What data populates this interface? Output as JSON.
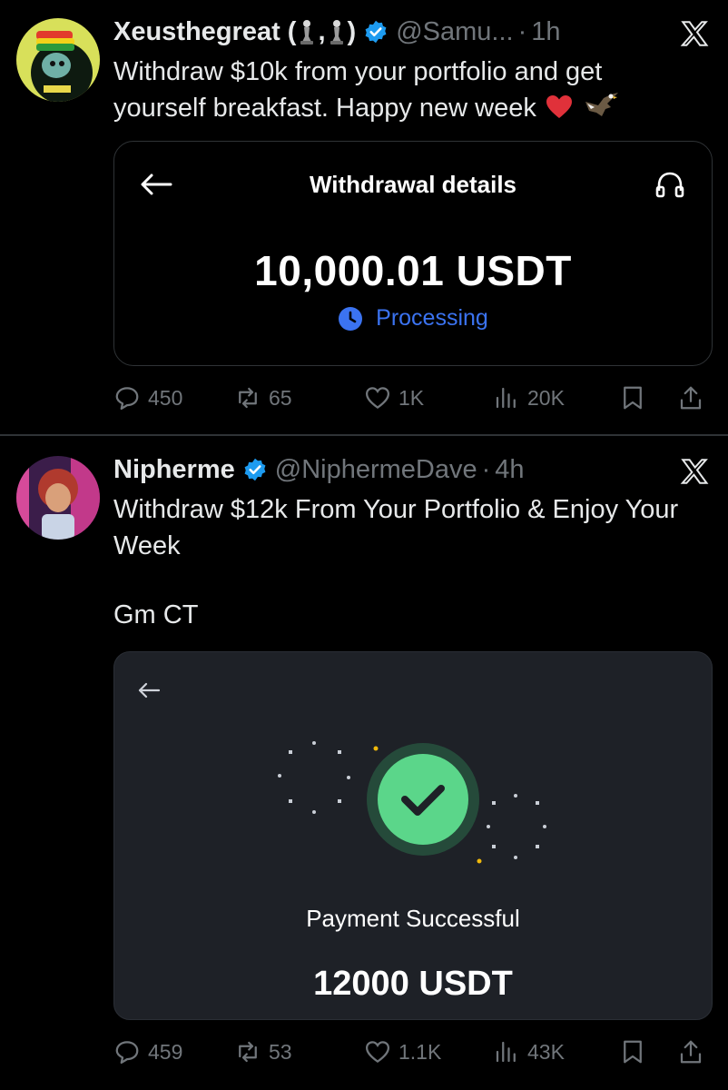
{
  "tweets": [
    {
      "name": "Xeusthegreat (",
      "name_mid": ",",
      "name_end": ")",
      "handle": "@Samu...",
      "sep": "·",
      "time": "1h",
      "text": "Withdraw $10k from your portfolio and get yourself breakfast. Happy new week",
      "card": {
        "title": "Withdrawal details",
        "amount": "10,000.01 USDT",
        "status": "Processing"
      },
      "stats": {
        "replies": "450",
        "reposts": "65",
        "likes": "1K",
        "views": "20K"
      }
    },
    {
      "name": "Nipherme",
      "handle": "@NiphermeDave",
      "sep": "·",
      "time": "4h",
      "text": "Withdraw $12k From Your Portfolio & Enjoy Your Week",
      "text2": "Gm CT",
      "card": {
        "status": "Payment Successful",
        "amount": "12000 USDT"
      },
      "stats": {
        "replies": "459",
        "reposts": "53",
        "likes": "1.1K",
        "views": "43K"
      }
    }
  ],
  "colors": {
    "background": "#000000",
    "text": "#e7e9ea",
    "muted": "#71767b",
    "verified": "#1d9bf0",
    "processing": "#3b73f1",
    "success": "#5bd68a",
    "card2_bg": "#1e2127"
  },
  "icons": [
    "verified-badge-icon",
    "x-logo-icon",
    "back-arrow-icon",
    "headset-icon",
    "clock-icon",
    "check-icon",
    "reply-icon",
    "repost-icon",
    "like-icon",
    "views-icon",
    "bookmark-icon",
    "share-icon"
  ]
}
